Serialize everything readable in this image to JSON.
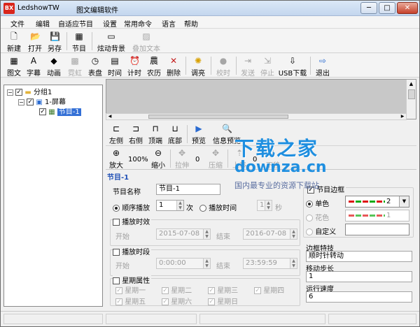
{
  "window": {
    "app_name": "LedshowTW",
    "subtitle": "图文编辑软件",
    "logo_text": "BX",
    "min": "─",
    "max": "□",
    "close": "✕"
  },
  "menu": [
    "文件",
    "编辑",
    "自适应节目",
    "设置",
    "常用命令",
    "语言",
    "帮助"
  ],
  "toolbar1": [
    {
      "label": "新建",
      "icon": "🗋",
      "disabled": false
    },
    {
      "label": "打开",
      "icon": "📂",
      "disabled": false
    },
    {
      "label": "另存",
      "icon": "💾",
      "disabled": false
    },
    {
      "label": "节目",
      "icon": "▦",
      "disabled": false
    },
    {
      "label": "炫动背景",
      "icon": "▭",
      "disabled": false
    },
    {
      "label": "叠加文本",
      "icon": "▨",
      "disabled": true
    }
  ],
  "toolbar2": [
    {
      "label": "图文",
      "icon": "▦",
      "disabled": false
    },
    {
      "label": "字幕",
      "icon": "A",
      "disabled": false
    },
    {
      "label": "动画",
      "icon": "◆",
      "disabled": false
    },
    {
      "label": "霓虹",
      "icon": "▩",
      "disabled": true
    },
    {
      "label": "表盘",
      "icon": "◷",
      "disabled": false
    },
    {
      "label": "时间",
      "icon": "▤",
      "disabled": false
    },
    {
      "label": "计时",
      "icon": "⏰",
      "disabled": false
    },
    {
      "label": "农历",
      "icon": "農",
      "disabled": false
    },
    {
      "label": "删除",
      "icon": "✕",
      "disabled": false
    },
    {
      "label": "调亮",
      "icon": "✺",
      "disabled": false
    },
    {
      "label": "校时",
      "icon": "●",
      "disabled": true
    },
    {
      "label": "发送",
      "icon": "⇥",
      "disabled": true
    },
    {
      "label": "停止",
      "icon": "⇲",
      "disabled": true
    },
    {
      "label": "USB下载",
      "icon": "⇩",
      "disabled": false
    },
    {
      "label": "退出",
      "icon": "⇨",
      "disabled": false
    }
  ],
  "tree": {
    "group": "分组1",
    "screen": "1-屏幕",
    "program": "节目-1"
  },
  "toolbar3": [
    {
      "label": "左侧",
      "icon": "⊏"
    },
    {
      "label": "右侧",
      "icon": "⊐"
    },
    {
      "label": "顶端",
      "icon": "⊓"
    },
    {
      "label": "底部",
      "icon": "⊔"
    },
    {
      "label": "预览",
      "icon": "▶"
    },
    {
      "label": "信息预览",
      "icon": "🔍"
    }
  ],
  "toolbar4": {
    "zoom_in": "放大",
    "zoom_value": "100%",
    "zoom_out": "缩小",
    "stretch": "拉伸",
    "stretch_value": "0",
    "compress": "压缩",
    "up": "上移",
    "up_value": "0",
    "down": "下移"
  },
  "props": {
    "header": "节目-1",
    "name_label": "节目名称",
    "name_value": "节目-1",
    "seq_play": "顺序播放",
    "seq_count": "1",
    "times_unit": "次",
    "time_play": "播放时间",
    "time_value": "1",
    "sec_unit": "秒",
    "date_effect": "播放时效",
    "start": "开始",
    "start_date": "2015-07-08",
    "end": "结束",
    "end_date": "2016-07-08",
    "time_period": "播放时段",
    "start_time": "0:00:00",
    "end_time": "23:59:59",
    "week_attr": "星期属性",
    "weekdays": [
      "星期一",
      "星期二",
      "星期三",
      "星期四",
      "星期五",
      "星期六",
      "星期日"
    ]
  },
  "border": {
    "title": "节目边框",
    "single": "单色",
    "flower": "花色",
    "custom": "自定义",
    "single_value": "2",
    "flower_value": "1",
    "effect_label": "边框特技",
    "effect_value": "顺时针转动",
    "step_label": "移动步长",
    "step_value": "1",
    "speed_label": "运行速度",
    "speed_value": "6"
  },
  "watermark": {
    "big": "下载之家",
    "mid": "downza.cn",
    "small": "国内最专业的资源下载站"
  },
  "colors": {
    "accent": "#1f4fb5",
    "watermark": "#1f8fe0",
    "title_bar": "#c3d6ee"
  }
}
